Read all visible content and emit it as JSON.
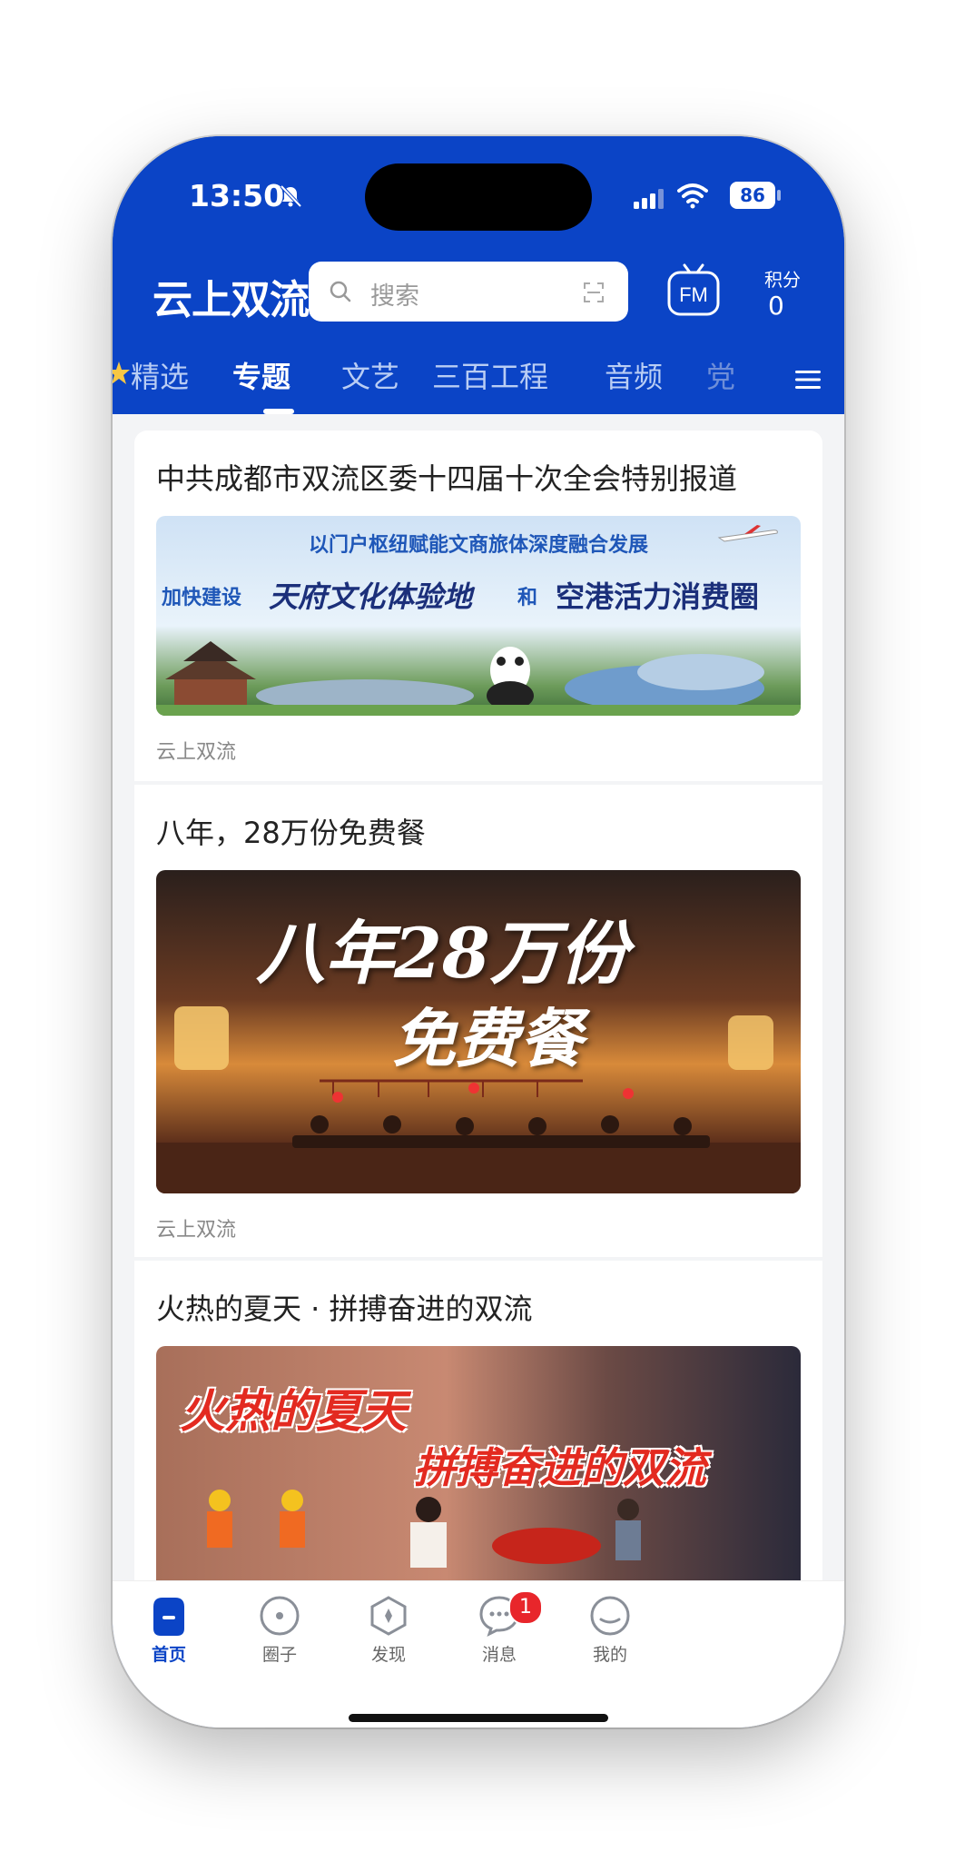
{
  "status_bar": {
    "time": "13:50",
    "battery": "86"
  },
  "header": {
    "logo": "云上双流",
    "search_placeholder": "搜索",
    "fm_label": "FM",
    "points_label": "积分",
    "points_value": "0"
  },
  "tabs": [
    {
      "label": "精选",
      "active": false
    },
    {
      "label": "专题",
      "active": true
    },
    {
      "label": "文艺",
      "active": false
    },
    {
      "label": "三百工程",
      "active": false
    },
    {
      "label": "音频",
      "active": false
    },
    {
      "label": "党",
      "active": false
    }
  ],
  "articles": [
    {
      "title": "中共成都市双流区委十四届十次全会特别报道",
      "source": "云上双流",
      "banner": {
        "line1": "以门户枢纽赋能文商旅体深度融合发展",
        "line2a": "加快建设",
        "line2b": "天府文化体验地",
        "line2c": "和",
        "line2d": "空港活力消费圈"
      }
    },
    {
      "title": "八年，28万份免费餐",
      "source": "云上双流",
      "banner": {
        "line1": "八年28万份",
        "line2": "免费餐"
      }
    },
    {
      "title": "火热的夏天 · 拼搏奋进的双流",
      "source": "",
      "banner": {
        "line1": "火热的夏天",
        "line2": "拼搏奋进的双流"
      }
    }
  ],
  "bottom_nav": [
    {
      "label": "首页",
      "icon": "home-icon",
      "active": true
    },
    {
      "label": "圈子",
      "icon": "circle-icon",
      "active": false
    },
    {
      "label": "发现",
      "icon": "compass-icon",
      "active": false
    },
    {
      "label": "消息",
      "icon": "message-icon",
      "active": false,
      "badge": "1"
    },
    {
      "label": "我的",
      "icon": "profile-icon",
      "active": false
    }
  ],
  "colors": {
    "brand": "#0b44c6",
    "badge": "#e8262b"
  }
}
